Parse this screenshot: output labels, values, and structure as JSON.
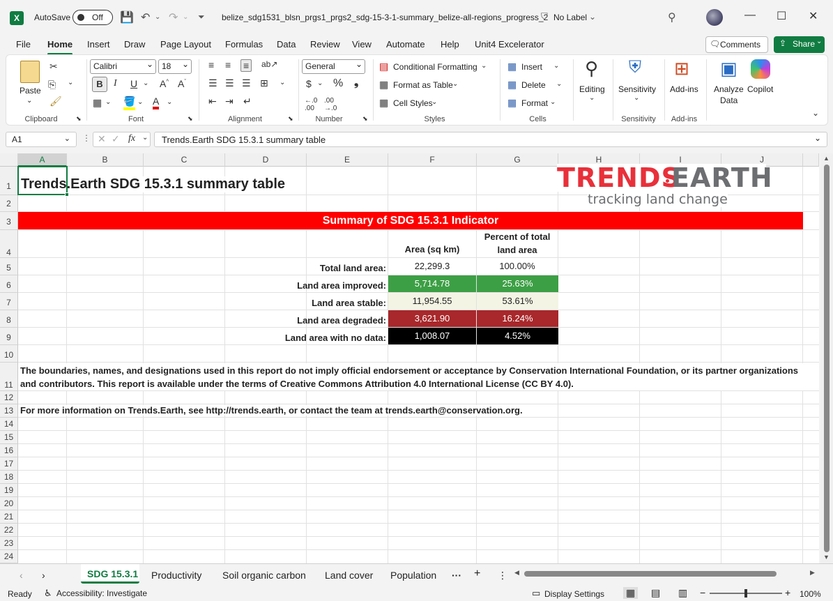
{
  "titlebar": {
    "autosave_label": "AutoSave",
    "autosave_state": "Off",
    "doc_title": "belize_sdg1531_blsn_prgs1_prgs2_sdg-15-3-1-summary_belize-all-regions_progress_2",
    "sensitivity_label": "No Label"
  },
  "menu": {
    "items": [
      "File",
      "Home",
      "Insert",
      "Draw",
      "Page Layout",
      "Formulas",
      "Data",
      "Review",
      "View",
      "Automate",
      "Help",
      "Unit4 Excelerator"
    ],
    "comments_label": "Comments",
    "share_label": "Share"
  },
  "ribbon": {
    "paste_label": "Paste",
    "font_name": "Calibri",
    "font_size": "18",
    "number_format": "General",
    "conditional_formatting": "Conditional Formatting",
    "format_as_table": "Format as Table",
    "cell_styles": "Cell Styles",
    "insert": "Insert",
    "delete": "Delete",
    "format": "Format",
    "editing": "Editing",
    "sensitivity": "Sensitivity",
    "add_ins": "Add-ins",
    "analyze_data_1": "Analyze",
    "analyze_data_2": "Data",
    "copilot": "Copilot",
    "groups": {
      "clipboard": "Clipboard",
      "font": "Font",
      "alignment": "Alignment",
      "number": "Number",
      "styles": "Styles",
      "cells": "Cells",
      "sensitivity": "Sensitivity",
      "add_ins": "Add-ins"
    }
  },
  "formula_bar": {
    "name_box": "A1",
    "formula": "Trends.Earth SDG 15.3.1 summary table"
  },
  "columns": [
    "A",
    "B",
    "C",
    "D",
    "E",
    "F",
    "G",
    "H",
    "I",
    "J"
  ],
  "rows": [
    "1",
    "2",
    "3",
    "4",
    "5",
    "6",
    "7",
    "8",
    "9",
    "10",
    "11",
    "12",
    "13",
    "14",
    "15",
    "16",
    "17",
    "18",
    "19",
    "20",
    "21",
    "22",
    "23",
    "24"
  ],
  "sheet": {
    "title": "Trends.Earth SDG 15.3.1 summary table",
    "logo_main_1": "TRENDS",
    "logo_main_2": "EARTH",
    "logo_tagline": "tracking land change",
    "banner": "Summary of SDG 15.3.1 Indicator",
    "header_area": "Area (sq km)",
    "header_pct_1": "Percent of total",
    "header_pct_2": "land area",
    "table": [
      {
        "label": "Total land area:",
        "area": "22,299.3",
        "pct": "100.00%",
        "color": "#ffffff"
      },
      {
        "label": "Land area improved:",
        "area": "5,714.78",
        "pct": "25.63%",
        "color": "#3d9f45"
      },
      {
        "label": "Land area stable:",
        "area": "11,954.55",
        "pct": "53.61%",
        "color": "#f4f4e4"
      },
      {
        "label": "Land area degraded:",
        "area": "3,621.90",
        "pct": "16.24%",
        "color": "#a8282b"
      },
      {
        "label": "Land area with no data:",
        "area": "1,008.07",
        "pct": "4.52%",
        "color": "#000000"
      }
    ],
    "disclaimer_1": "The boundaries, names, and designations used in this report do not imply official endorsement or acceptance by Conservation International Foundation, or its partner organizations",
    "disclaimer_2": "and contributors.  This report is available under the terms of Creative Commons Attribution 4.0 International License (CC BY 4.0).",
    "more_info": "For more information on Trends.Earth, see http://trends.earth, or contact the team at trends.earth@conservation.org."
  },
  "tabs": [
    "SDG 15.3.1",
    "Productivity",
    "Soil organic carbon",
    "Land cover",
    "Population"
  ],
  "status": {
    "ready": "Ready",
    "accessibility": "Accessibility: Investigate",
    "display_settings": "Display Settings",
    "zoom": "100%"
  },
  "colors": {
    "accent": "#107c41",
    "banner": "#ff0000",
    "logo_red": "#e8303a",
    "logo_gray": "#6d6e71"
  }
}
